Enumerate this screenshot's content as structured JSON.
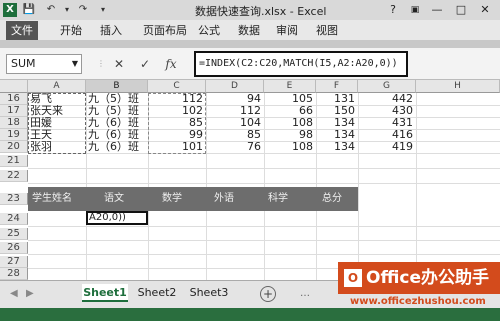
{
  "window": {
    "title": "数据快速查询.xlsx - Excel",
    "help": "?",
    "restore_icon": "restore-icon",
    "min": "—",
    "max": "□",
    "close": "✕",
    "logo": "X"
  },
  "quick_access": {
    "save": "💾",
    "undo": "↶",
    "redo": "↷",
    "customize": "▾"
  },
  "ribbon": {
    "tabs": [
      "文件",
      "开始",
      "插入",
      "页面布局",
      "公式",
      "数据",
      "审阅",
      "视图"
    ]
  },
  "formula_bar": {
    "name_box": "SUM",
    "cancel": "✕",
    "enter": "✓",
    "fx": "fx",
    "formula": "=INDEX(C2:C20,MATCH(I5,A2:A20,0))"
  },
  "columns": [
    "A",
    "B",
    "C",
    "D",
    "E",
    "F",
    "G",
    "H"
  ],
  "rows": [
    {
      "num": "16",
      "A": "易飞",
      "B": "九（5）班",
      "C": "112",
      "D": "94",
      "E": "105",
      "F": "131",
      "G": "442"
    },
    {
      "num": "17",
      "A": "张天来",
      "B": "九（5）班",
      "C": "102",
      "D": "112",
      "E": "66",
      "F": "150",
      "G": "430"
    },
    {
      "num": "18",
      "A": "田媛",
      "B": "九（6）班",
      "C": "85",
      "D": "104",
      "E": "108",
      "F": "134",
      "G": "431"
    },
    {
      "num": "19",
      "A": "王天",
      "B": "九（6）班",
      "C": "99",
      "D": "85",
      "E": "98",
      "F": "134",
      "G": "416"
    },
    {
      "num": "20",
      "A": "张羽",
      "B": "九（6）班",
      "C": "101",
      "D": "76",
      "E": "108",
      "F": "134",
      "G": "419"
    },
    {
      "num": "21"
    },
    {
      "num": "22"
    },
    {
      "num": "23"
    },
    {
      "num": "24"
    },
    {
      "num": "25"
    },
    {
      "num": "26"
    },
    {
      "num": "27"
    },
    {
      "num": "28"
    }
  ],
  "header_band": [
    "学生姓名",
    "语文",
    "数学",
    "外语",
    "科学",
    "总分"
  ],
  "edit_cell": "A20,0))",
  "sheets": {
    "tabs": [
      "Sheet1",
      "Sheet2",
      "Sheet3"
    ],
    "active": "Sheet1",
    "add": "+",
    "nav_prev": "◀",
    "nav_next": "▶",
    "more": "…"
  },
  "watermark": {
    "logo": "O",
    "text": "Office办公助手",
    "url": "www.officezhushou.com"
  },
  "colors": {
    "accent": "#1e6e3c",
    "watermark": "#d34b1c",
    "band": "#6d6d6d"
  }
}
